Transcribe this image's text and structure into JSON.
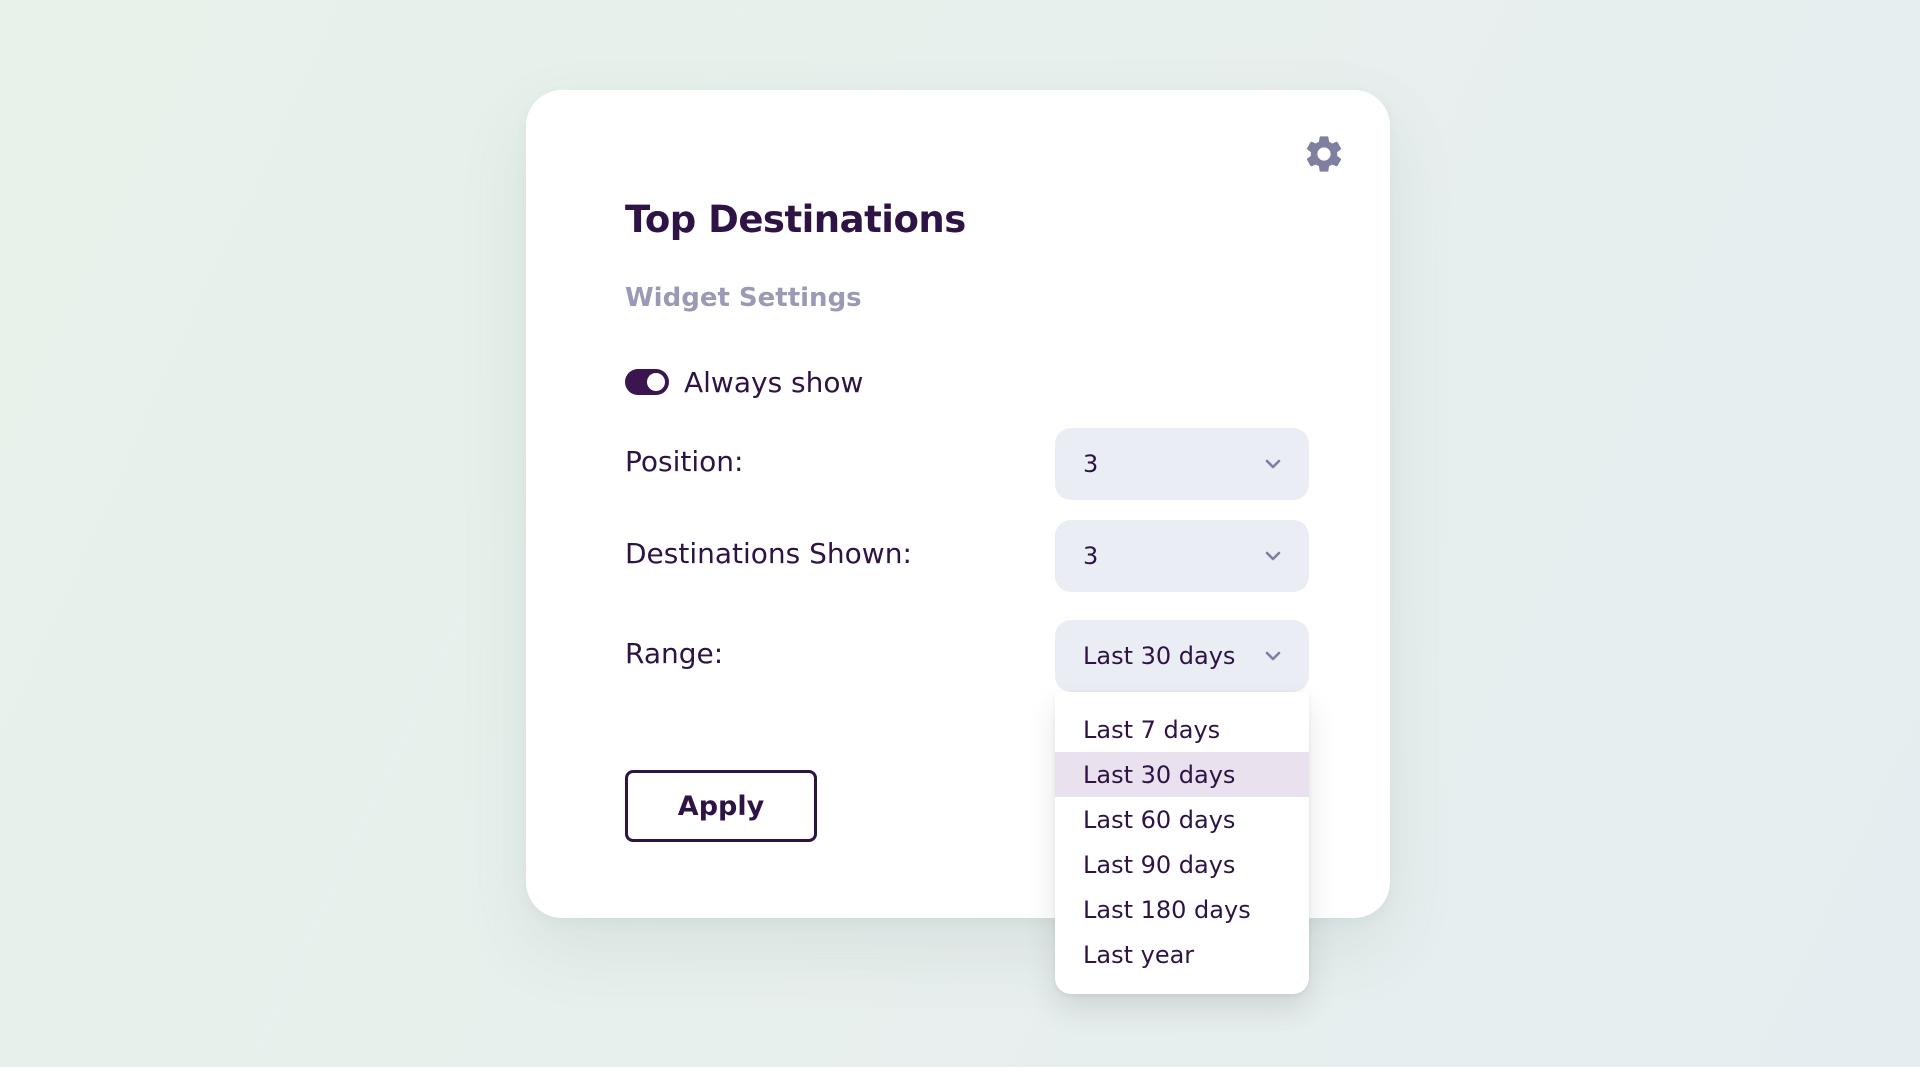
{
  "widget": {
    "title": "Top Destinations",
    "subtitle": "Widget Settings",
    "settings_icon": "gear-icon",
    "toggle": {
      "label": "Always show",
      "on": true
    },
    "fields": {
      "position": {
        "label": "Position:",
        "value": "3"
      },
      "destinations_shown": {
        "label": "Destinations Shown:",
        "value": "3"
      },
      "range": {
        "label": "Range:",
        "value": "Last 30 days",
        "options": [
          "Last 7 days",
          "Last 30 days",
          "Last 60 days",
          "Last 90 days",
          "Last 180 days",
          "Last year"
        ],
        "selected_index": 1
      }
    },
    "apply_label": "Apply"
  },
  "colors": {
    "primary": "#2e1445",
    "muted_text": "#9a9ab6",
    "select_bg": "#eaedf3",
    "selected_option_bg": "#eae1ee",
    "icon": "#7f7f9f"
  }
}
